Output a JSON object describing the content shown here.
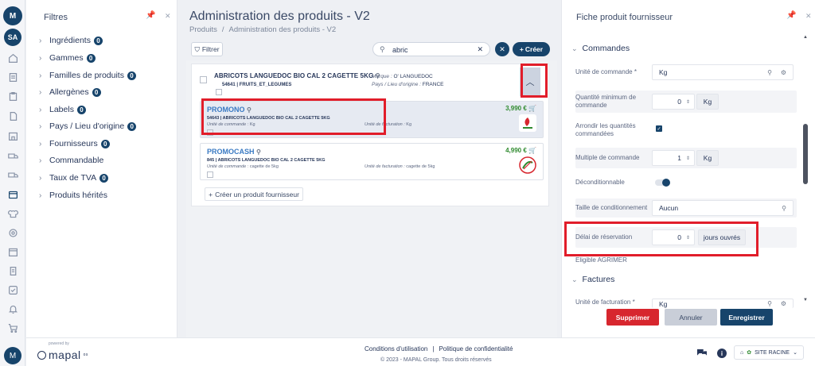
{
  "rail": {
    "logo": "M",
    "avatar": "SA",
    "footer_logo": "M",
    "icons": [
      "home-icon",
      "notes-icon",
      "clipboard-icon",
      "document-icon",
      "store-icon",
      "truck-icon",
      "warehouse-truck-icon",
      "box-icon",
      "chef-hat-icon",
      "settings-icon",
      "calendar-icon",
      "invoice-icon",
      "checklist-icon",
      "bell-icon",
      "cart-icon"
    ]
  },
  "filters": {
    "title": "Filtres",
    "items": [
      {
        "label": "Ingrédients",
        "count": "0"
      },
      {
        "label": "Gammes",
        "count": "0"
      },
      {
        "label": "Familles de produits",
        "count": "0"
      },
      {
        "label": "Allergènes",
        "count": "0"
      },
      {
        "label": "Labels",
        "count": "0"
      },
      {
        "label": "Pays / Lieu d'origine",
        "count": "0"
      },
      {
        "label": "Fournisseurs",
        "count": "0"
      },
      {
        "label": "Commandable",
        "count": ""
      },
      {
        "label": "Taux de TVA",
        "count": "0"
      },
      {
        "label": "Produits hérités",
        "count": ""
      }
    ]
  },
  "main": {
    "title": "Administration des produits - V2",
    "breadcrumb": [
      "Produits",
      "Administration des produits - V2"
    ],
    "filter_label": "Filtrer",
    "search_value": "abric",
    "create_label": "Créer",
    "product": {
      "name": "ABRICOTS LANGUEDOC BIO CAL 2 CAGETTE 5KG",
      "sub": "54641 | FRUITS_ET_LEGUMES",
      "brand_label": "Marque :",
      "brand_value": "O' LANGUEDOC",
      "origin_label": "Pays / Lieu d'origine :",
      "origin_value": "FRANCE"
    },
    "suppliers": [
      {
        "name": "PROMONO",
        "desc": "54643 | ABRICOTS LANGUEDOC BIO CAL 2 CAGETTE 5KG",
        "unit_label": "Unité de commande :",
        "unit_value": "Kg",
        "fact_label": "Unité de facturation :",
        "fact_value": "Kg",
        "price": "3,990 €"
      },
      {
        "name": "PROMOCASH",
        "desc": "845 | ABRICOTS LANGUEDOC BIO CAL 2 CAGETTE 5KG",
        "unit_label": "Unité de commande :",
        "unit_value": "cagette de 5kg",
        "fact_label": "Unité de facturation :",
        "fact_value": "cagette de 5kg",
        "price": "4,990 €"
      }
    ],
    "create_supplier_label": "Créer un produit fournisseur"
  },
  "fiche": {
    "title": "Fiche produit fournisseur",
    "sections": {
      "commandes": "Commandes",
      "factures": "Factures"
    },
    "unite_commande": {
      "label": "Unité de commande *",
      "value": "Kg"
    },
    "qte_min": {
      "label": "Quantité minimum de commande",
      "value": "0",
      "unit": "Kg"
    },
    "arrondir": {
      "label": "Arrondir les quantités commandées",
      "checked": true
    },
    "multiple": {
      "label": "Multiple de commande",
      "value": "1",
      "unit": "Kg"
    },
    "deconditionnable": {
      "label": "Déconditionnable",
      "on": true
    },
    "taille": {
      "label": "Taille de conditionnement",
      "value": "Aucun"
    },
    "delai": {
      "label": "Délai de réservation",
      "value": "0",
      "unit": "jours ouvrés"
    },
    "agrimer": {
      "label": "Eligible AGRIMER"
    },
    "unite_facturation": {
      "label": "Unité de facturation *",
      "value": "Kg"
    },
    "actions": {
      "delete": "Supprimer",
      "cancel": "Annuler",
      "save": "Enregistrer"
    }
  },
  "footer": {
    "powered": "powered by",
    "brand": "mapal",
    "brand_suffix": "os",
    "terms": "Conditions d'utilisation",
    "privacy": "Politique de confidentialité",
    "copyright": "© 2023 - MAPAL Group. Tous droits réservés",
    "site": "SITE RACINE"
  },
  "colors": {
    "accent": "#17446b",
    "highlight": "#e11d2a",
    "price": "#2f8a2f",
    "danger": "#d7262e"
  }
}
